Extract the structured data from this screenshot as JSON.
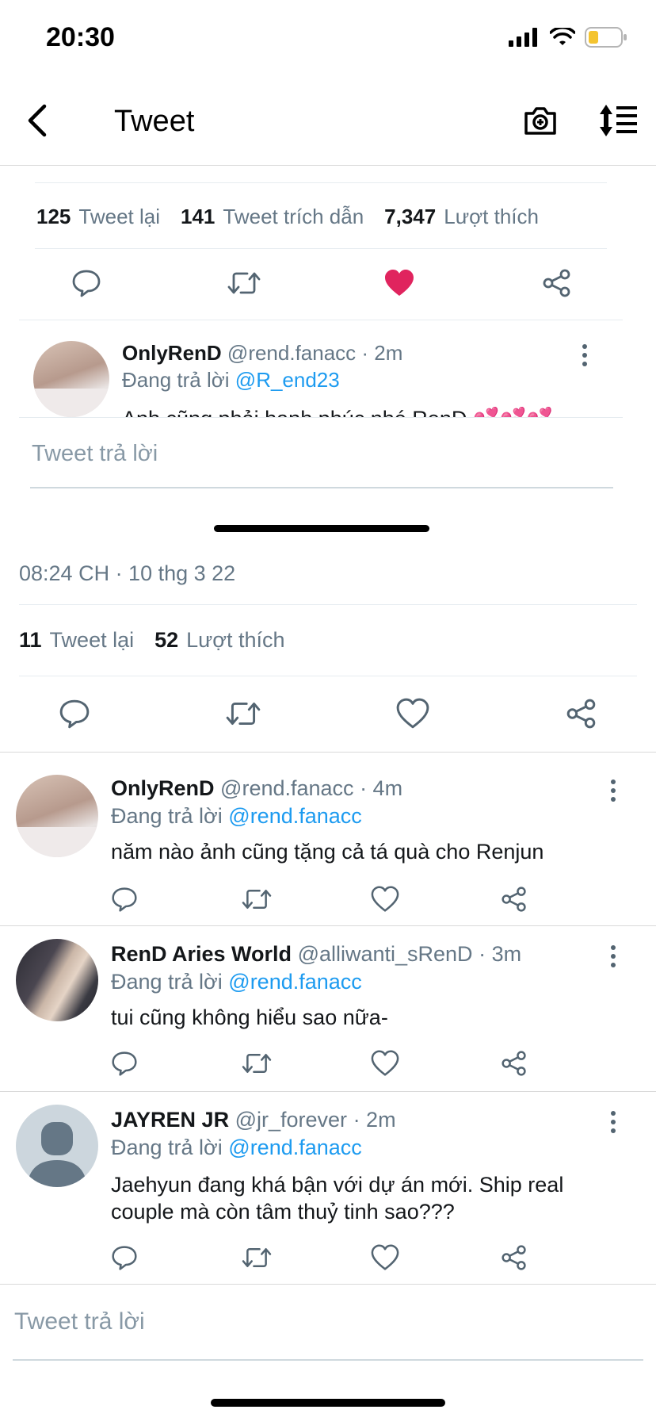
{
  "status_bar": {
    "time": "20:30"
  },
  "navbar": {
    "title": "Tweet"
  },
  "overlay": {
    "stats": [
      {
        "count": "125",
        "label": "Tweet lại"
      },
      {
        "count": "141",
        "label": "Tweet trích dẫn"
      },
      {
        "count": "7,347",
        "label": "Lượt thích"
      }
    ],
    "reply": {
      "name": "OnlyRenD",
      "handle": "@rend.fanacc",
      "time": "· 2m",
      "replying_prefix": "Đang trả lời",
      "replying_to": "@R_end23",
      "text": "Anh cũng phải hạnh phúc nhé RenD 💕💕💕"
    },
    "composer_placeholder": "Tweet trả lời"
  },
  "tweet": {
    "timestamp": "08:24 CH · 10 thg 3 22",
    "stats": [
      {
        "count": "11",
        "label": "Tweet lại"
      },
      {
        "count": "52",
        "label": "Lượt thích"
      }
    ]
  },
  "replies": [
    {
      "name": "OnlyRenD",
      "handle": "@rend.fanacc",
      "time": "· 4m",
      "replying_prefix": "Đang trả lời",
      "replying_to": "@rend.fanacc",
      "text": "năm nào ảnh cũng tặng cả tá quà cho Renjun"
    },
    {
      "name": "RenD Aries World",
      "handle": "@alliwanti_sRenD",
      "time": "· 3m",
      "replying_prefix": "Đang trả lời",
      "replying_to": "@rend.fanacc",
      "text": "tui cũng không hiểu sao nữa-"
    },
    {
      "name": "JAYREN JR",
      "handle": "@jr_forever",
      "time": "· 2m",
      "replying_prefix": "Đang trả lời",
      "replying_to": "@rend.fanacc",
      "text": "Jaehyun đang khá bận với dự án mới. Ship real couple mà còn tâm thuỷ tinh sao???"
    }
  ],
  "composer": {
    "placeholder": "Tweet trả lời"
  },
  "icons": {
    "back": "chevron-left-icon",
    "camera": "camera-icon",
    "sort": "sort-lines-icon",
    "reply": "comment-icon",
    "retweet": "retweet-icon",
    "like": "heart-icon",
    "share": "share-icon"
  },
  "colors": {
    "accent": "#1d9bf0",
    "like_active": "#e0245e",
    "muted": "#657786"
  }
}
